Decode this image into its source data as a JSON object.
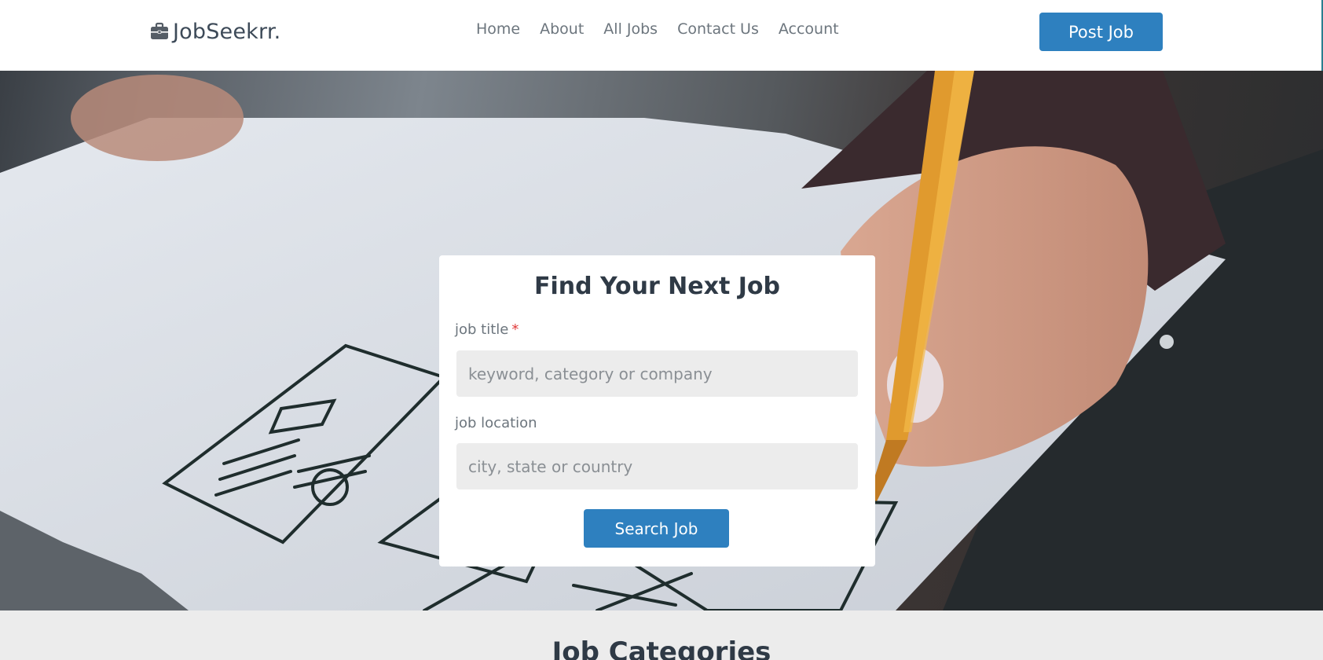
{
  "brand": {
    "name": "JobSeekrr.",
    "icon": "briefcase-icon"
  },
  "nav": {
    "links": [
      "Home",
      "About",
      "All Jobs",
      "Contact Us",
      "Account"
    ],
    "post_job_label": "Post Job"
  },
  "search": {
    "title": "Find Your Next Job",
    "job_title_label": "job title",
    "required_marker": "*",
    "job_title_placeholder": "keyword, category or company",
    "job_location_label": "job location",
    "job_location_placeholder": "city, state or country",
    "submit_label": "Search Job"
  },
  "categories": {
    "title": "Job Categories"
  },
  "colors": {
    "primary": "#2e80bf",
    "heading": "#2f3a46",
    "muted": "#6c757d",
    "required": "#e03a3a",
    "section_bg": "#ececec"
  }
}
